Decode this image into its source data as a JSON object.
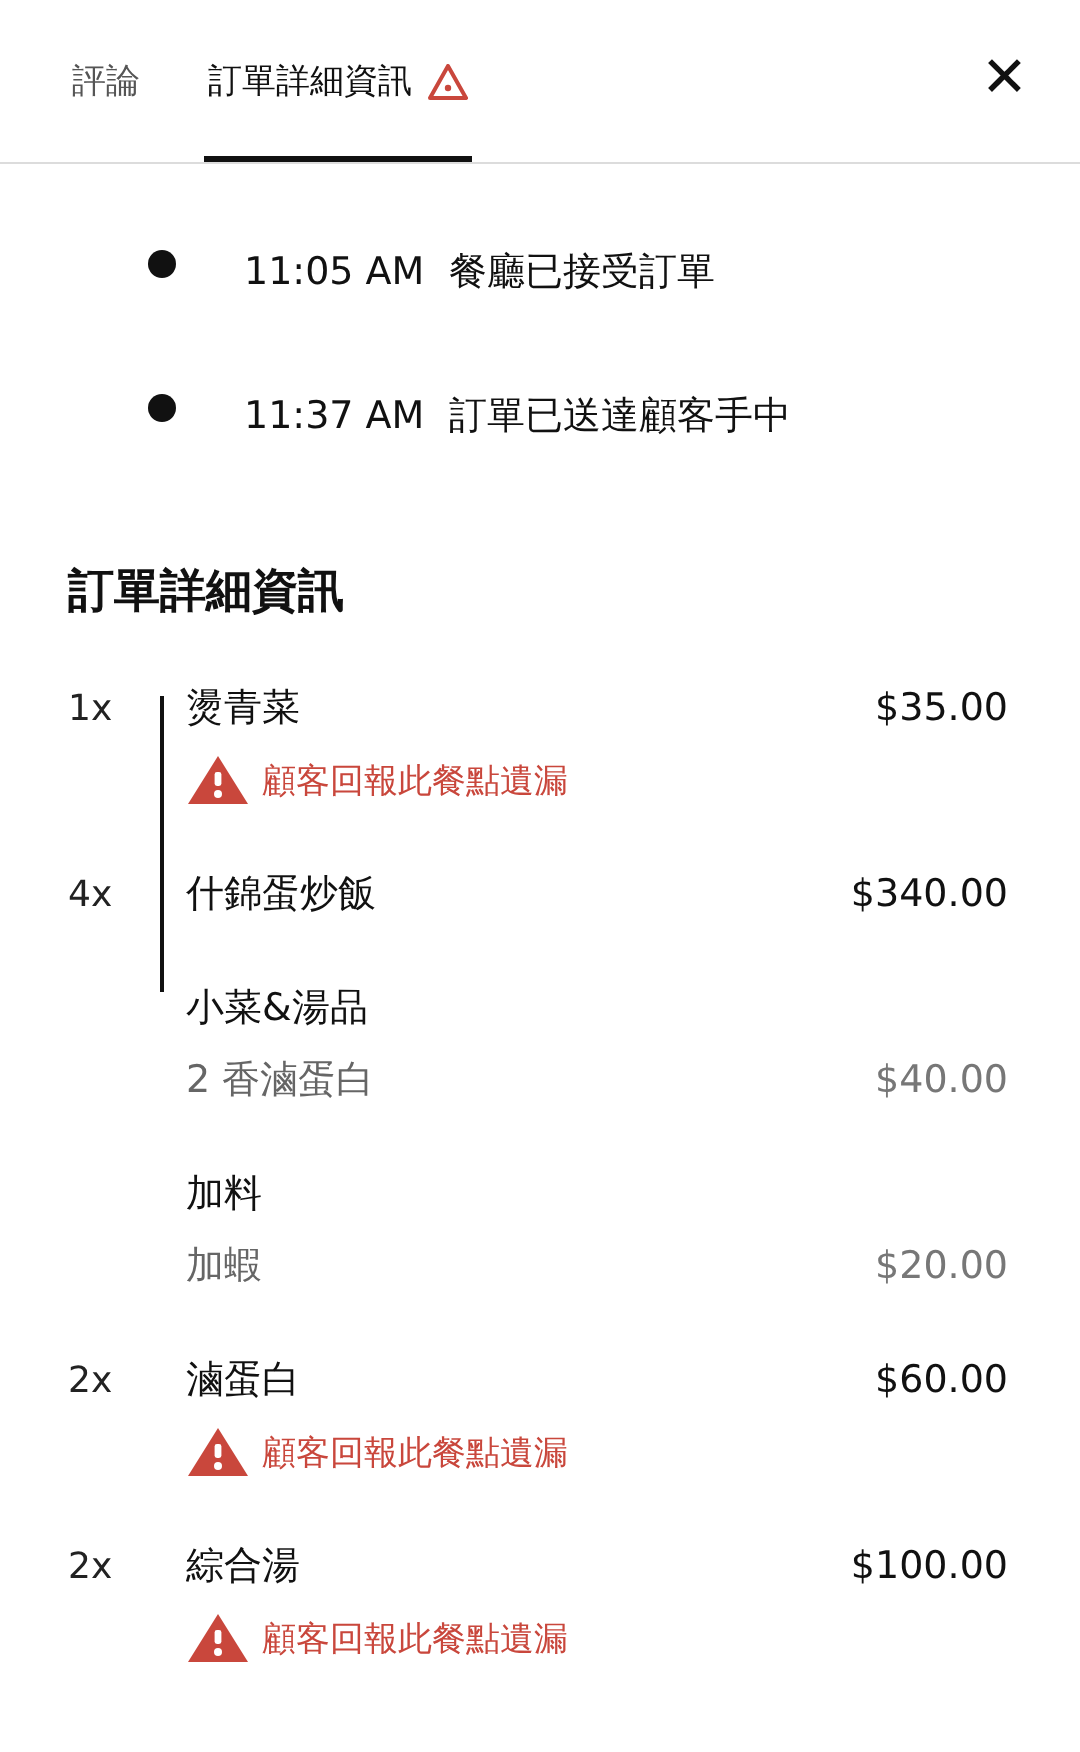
{
  "tabs": [
    {
      "label": "評論",
      "selected": false,
      "warning": false
    },
    {
      "label": "訂單詳細資訊",
      "selected": true,
      "warning": true
    }
  ],
  "close_label": "✕",
  "timeline": [
    {
      "time": "11:05 AM",
      "event": "餐廳已接受訂單"
    },
    {
      "time": "11:37 AM",
      "event": "訂單已送達顧客手中"
    }
  ],
  "details": {
    "title": "訂單詳細資訊",
    "items": [
      {
        "qty": "1x",
        "name": "燙青菜",
        "price": "$35.00",
        "warning": "顧客回報此餐點遺漏"
      },
      {
        "qty": "4x",
        "name": "什錦蛋炒飯",
        "price": "$340.00",
        "groups": [
          {
            "title": "小菜&湯品",
            "options": [
              {
                "name": "2 香滷蛋白",
                "price": "$40.00"
              }
            ]
          },
          {
            "title": "加料",
            "options": [
              {
                "name": "加蝦",
                "price": "$20.00"
              }
            ]
          }
        ]
      },
      {
        "qty": "2x",
        "name": "滷蛋白",
        "price": "$60.00",
        "warning": "顧客回報此餐點遺漏"
      },
      {
        "qty": "2x",
        "name": "綜合湯",
        "price": "$100.00",
        "warning": "顧客回報此餐點遺漏"
      }
    ]
  }
}
